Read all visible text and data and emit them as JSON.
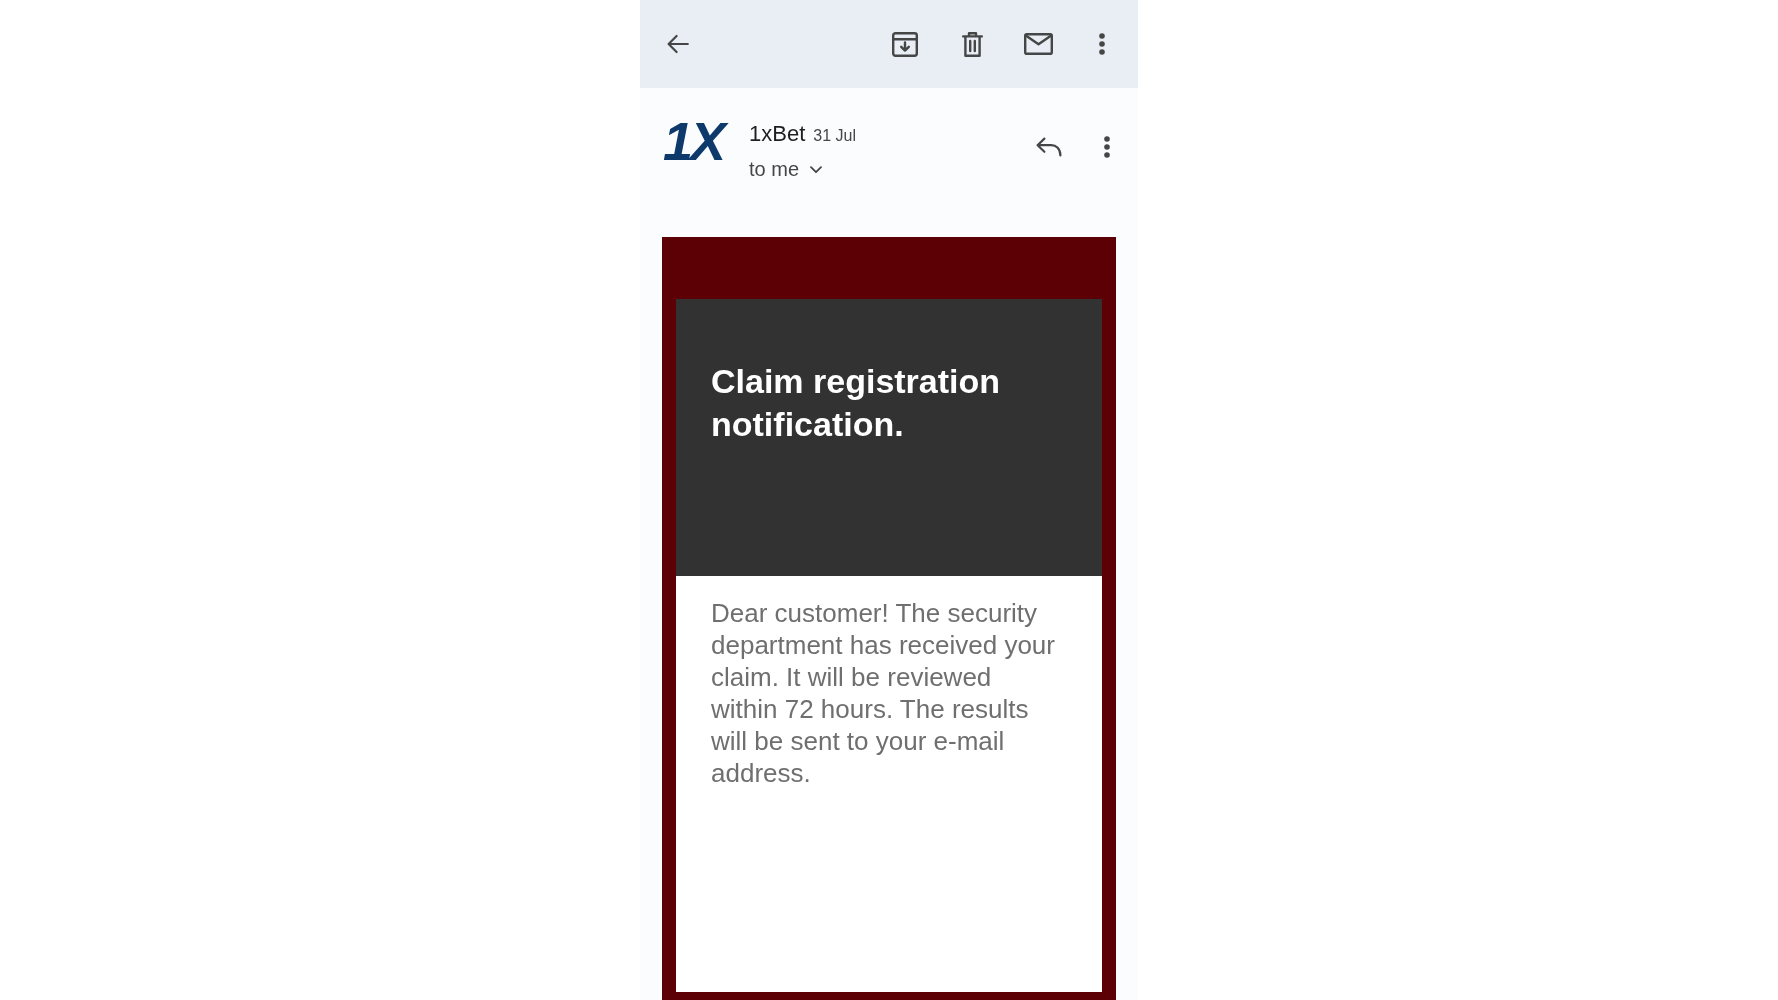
{
  "message_header": {
    "logo": "1X",
    "sender": "1xBet",
    "date": "31 Jul",
    "recipient": "to me"
  },
  "email_body": {
    "heading": "Claim registration notification.",
    "text": "Dear customer! The security department has received your claim. It will be reviewed within 72 hours. The results will be sent to your e-mail address."
  }
}
